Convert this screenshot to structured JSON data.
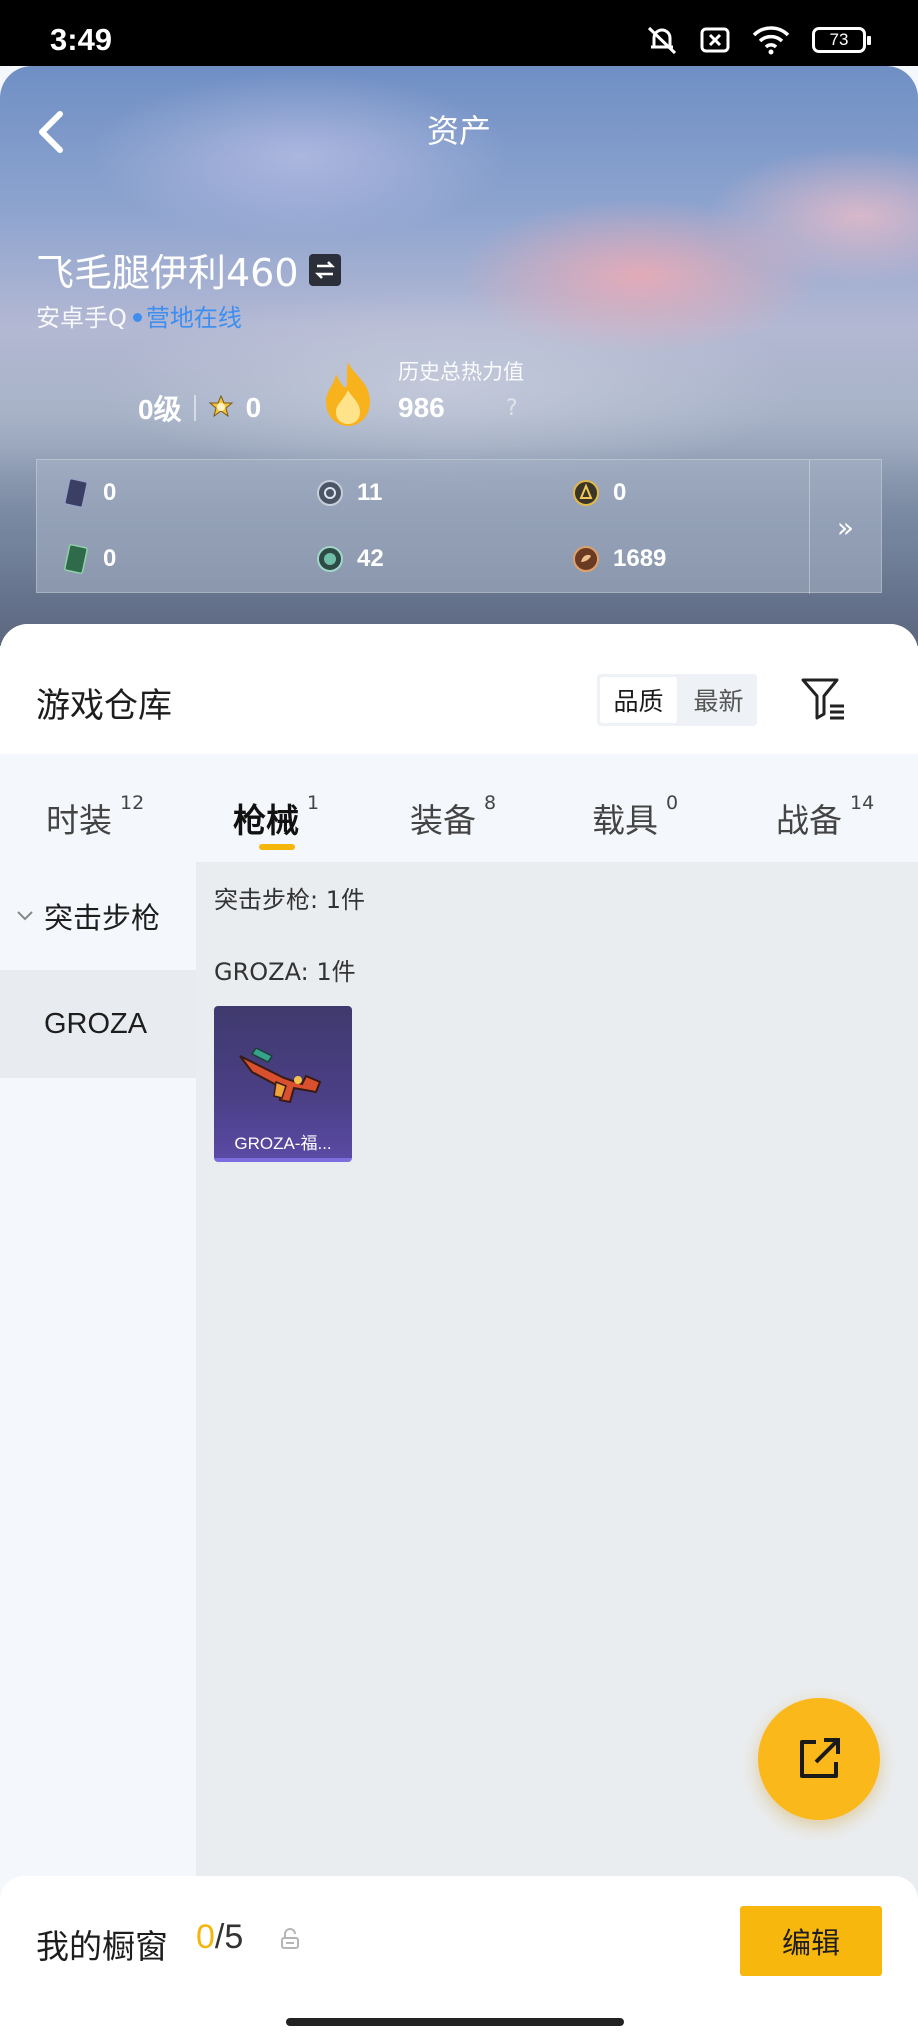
{
  "status_bar": {
    "time": "3:49",
    "battery": "73"
  },
  "header": {
    "title": "资产",
    "player_name": "飞毛腿伊利460",
    "account": "安卓手Q",
    "online_status": "营地在线",
    "level": "0级",
    "medal_count": "0",
    "heat_label": "历史总热力值",
    "heat_value": "986",
    "heat_help": "?"
  },
  "stats": {
    "row1": [
      "0",
      "11",
      "0"
    ],
    "row2": [
      "0",
      "42",
      "1689"
    ],
    "more": "»"
  },
  "warehouse": {
    "title": "游戏仓库",
    "sort_options": [
      "品质",
      "最新"
    ],
    "sort_selected": "品质"
  },
  "tabs": [
    {
      "label": "时装",
      "count": "12"
    },
    {
      "label": "枪械",
      "count": "1",
      "active": true
    },
    {
      "label": "装备",
      "count": "8"
    },
    {
      "label": "载具",
      "count": "0"
    },
    {
      "label": "战备",
      "count": "14"
    }
  ],
  "sidebar": {
    "group": "突击步枪",
    "items": [
      "GROZA"
    ]
  },
  "content": {
    "category_summary": "突击步枪: 1件",
    "weapon_summary": "GROZA: 1件",
    "items": [
      {
        "name": "GROZA-福..."
      }
    ]
  },
  "bottom": {
    "showcase_label": "我的橱窗",
    "showcase_current": "0",
    "showcase_total": "/5",
    "edit_label": "编辑"
  },
  "colors": {
    "accent": "#f7b70d",
    "online": "#3d8ef0",
    "item_rarity": "#5a4aa4"
  }
}
